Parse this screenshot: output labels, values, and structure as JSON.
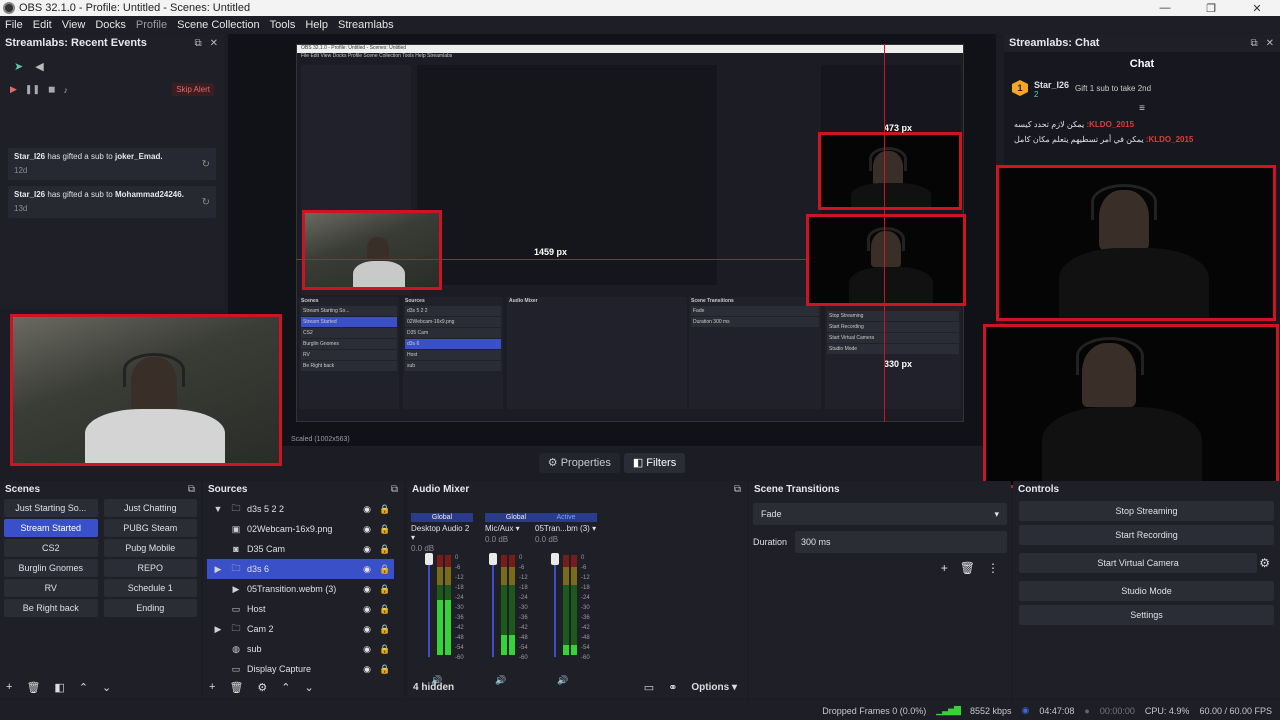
{
  "window": {
    "title": "OBS 32.1.0 - Profile: Untitled - Scenes: Untitled",
    "controls": [
      "—",
      "❐",
      "✕"
    ]
  },
  "menu": [
    "File",
    "Edit",
    "View",
    "Docks",
    "Profile",
    "Scene Collection",
    "Tools",
    "Help",
    "Streamlabs"
  ],
  "events_dock": {
    "title": "Streamlabs: Recent Events",
    "skip_alert": "Skip Alert",
    "events": [
      {
        "user": "Star_I26",
        "action": "has gifted a sub to",
        "target": "joker_Emad.",
        "time": "12d"
      },
      {
        "user": "Star_I26",
        "action": "has gifted a sub to",
        "target": "Mohammad24246.",
        "time": "13d"
      }
    ]
  },
  "preview": {
    "scaled_label": "Scaled (1002x563)",
    "px_labels": [
      "1459 px",
      "473 px",
      "330 px"
    ],
    "tabs": [
      "Properties",
      "Filters"
    ]
  },
  "nested": {
    "title": "OBS 32.1.0 - Profile: Untitled - Scenes: Untitled",
    "menu": "File  Edit  View  Docks  Profile  Scene Collection  Tools  Help  Streamlabs",
    "scenes_title": "Scenes",
    "sources_title": "Sources",
    "mixer_title": "Audio Mixer",
    "transitions_title": "Scene Transitions",
    "controls": [
      "Stop Streaming",
      "Start Recording",
      "Start Virtual Camera",
      "Studio Mode"
    ]
  },
  "chat_dock": {
    "title": "Streamlabs: Chat",
    "header": "Chat",
    "sub_user": "Star_I26",
    "sub_count": "2",
    "sub_text": "Gift 1 sub to take 2nd",
    "messages": [
      {
        "user": "KLDO_2015:",
        "text": "يمكن لازم تحدد كيسه"
      },
      {
        "user": "KLDO_2015:",
        "text": "يمكن في أمر تسطيهم يتعلم مكان كامل"
      }
    ]
  },
  "scenes": {
    "title": "Scenes",
    "items": [
      "Just Starting So...",
      "Just Chatting",
      "Stream Started",
      "PUBG Steam",
      "CS2",
      "Pubg Mobile",
      "Burglin Gnomes",
      "REPO",
      "RV",
      "Schedule 1",
      "Be Right back",
      "Ending"
    ],
    "selected": "Stream Started"
  },
  "sources": {
    "title": "Sources",
    "items": [
      {
        "name": "d3s 5 2 2",
        "icon": "folder",
        "expand": "▼"
      },
      {
        "name": "02Webcam-16x9.png",
        "icon": "image",
        "expand": ""
      },
      {
        "name": "D35 Cam",
        "icon": "camera",
        "expand": ""
      },
      {
        "name": "d3s 6",
        "icon": "folder",
        "expand": "▶"
      },
      {
        "name": "05Transition.webm (3)",
        "icon": "play",
        "expand": ""
      },
      {
        "name": "Host",
        "icon": "monitor",
        "expand": ""
      },
      {
        "name": "Cam 2",
        "icon": "folder",
        "expand": "▶"
      },
      {
        "name": "sub",
        "icon": "globe",
        "expand": ""
      },
      {
        "name": "Display Capture",
        "icon": "monitor",
        "expand": ""
      }
    ]
  },
  "mixer": {
    "title": "Audio Mixer",
    "channels": [
      {
        "tag": "Global",
        "name": "Desktop Audio 2",
        "db": "0.0 dB",
        "level": 0.55
      },
      {
        "tag": "Global",
        "name": "Mic/Aux",
        "db": "0.0 dB",
        "level": 0.2
      },
      {
        "tag": "Active",
        "name": "05Tran...bm (3)",
        "db": "0.0 dB",
        "level": 0.1
      }
    ],
    "scale": [
      "0",
      "-6",
      "-12",
      "-18",
      "-24",
      "-30",
      "-36",
      "-42",
      "-48",
      "-54",
      "-60"
    ],
    "hidden": "4 hidden",
    "options": "Options"
  },
  "transitions": {
    "title": "Scene Transitions",
    "type": "Fade",
    "duration_label": "Duration",
    "duration_value": "300 ms"
  },
  "controls": {
    "title": "Controls",
    "buttons": [
      "Stop Streaming",
      "Start Recording",
      "Start Virtual Camera",
      "Studio Mode",
      "Settings"
    ]
  },
  "status": {
    "dropped": "Dropped Frames 0 (0.0%)",
    "bitrate": "8552 kbps",
    "stream_time": "04:47:08",
    "rec_time": "00:00:00",
    "cpu": "CPU: 4.9%",
    "fps": "60.00 / 60.00 FPS"
  }
}
